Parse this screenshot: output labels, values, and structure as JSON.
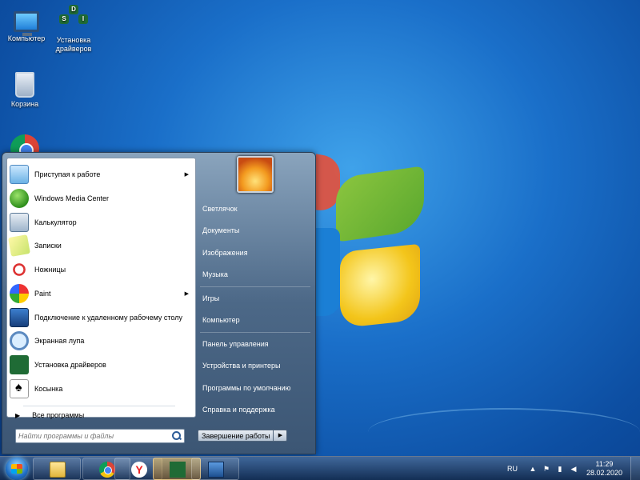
{
  "desktop": {
    "icons": [
      {
        "label": "Компьютер"
      },
      {
        "label": "Установка драйверов"
      },
      {
        "label": "Корзина"
      }
    ],
    "sdi_letters": [
      "S",
      "D",
      "I"
    ]
  },
  "start_menu": {
    "programs": [
      {
        "label": "Приступая к работе",
        "has_submenu": true,
        "icon": "getting-started-icon"
      },
      {
        "label": "Windows Media Center",
        "has_submenu": false,
        "icon": "media-center-icon"
      },
      {
        "label": "Калькулятор",
        "has_submenu": false,
        "icon": "calculator-icon"
      },
      {
        "label": "Записки",
        "has_submenu": false,
        "icon": "sticky-notes-icon"
      },
      {
        "label": "Ножницы",
        "has_submenu": false,
        "icon": "snipping-tool-icon"
      },
      {
        "label": "Paint",
        "has_submenu": true,
        "icon": "paint-icon"
      },
      {
        "label": "Подключение к удаленному рабочему столу",
        "has_submenu": false,
        "icon": "remote-desktop-icon"
      },
      {
        "label": "Экранная лупа",
        "has_submenu": false,
        "icon": "magnifier-icon"
      },
      {
        "label": "Установка драйверов",
        "has_submenu": false,
        "icon": "driver-installer-icon"
      },
      {
        "label": "Косынка",
        "has_submenu": false,
        "icon": "solitaire-icon"
      }
    ],
    "all_programs": "Все программы",
    "search_placeholder": "Найти программы и файлы",
    "right_items": [
      {
        "label": "Светлячок"
      },
      {
        "label": "Документы"
      },
      {
        "label": "Изображения"
      },
      {
        "label": "Музыка"
      },
      {
        "label": "Игры"
      },
      {
        "label": "Компьютер"
      },
      {
        "label": "Панель управления"
      },
      {
        "label": "Устройства и принтеры"
      },
      {
        "label": "Программы по умолчанию"
      },
      {
        "label": "Справка и поддержка"
      }
    ],
    "shutdown_label": "Завершение работы"
  },
  "taskbar": {
    "language": "RU",
    "time": "11:29",
    "date": "28.02.2020",
    "pinned": [
      "explorer-icon",
      "chrome-icon",
      "yandex-browser-icon",
      "driver-installer-icon",
      "remote-desktop-icon"
    ],
    "yandex_letter": "Y"
  }
}
